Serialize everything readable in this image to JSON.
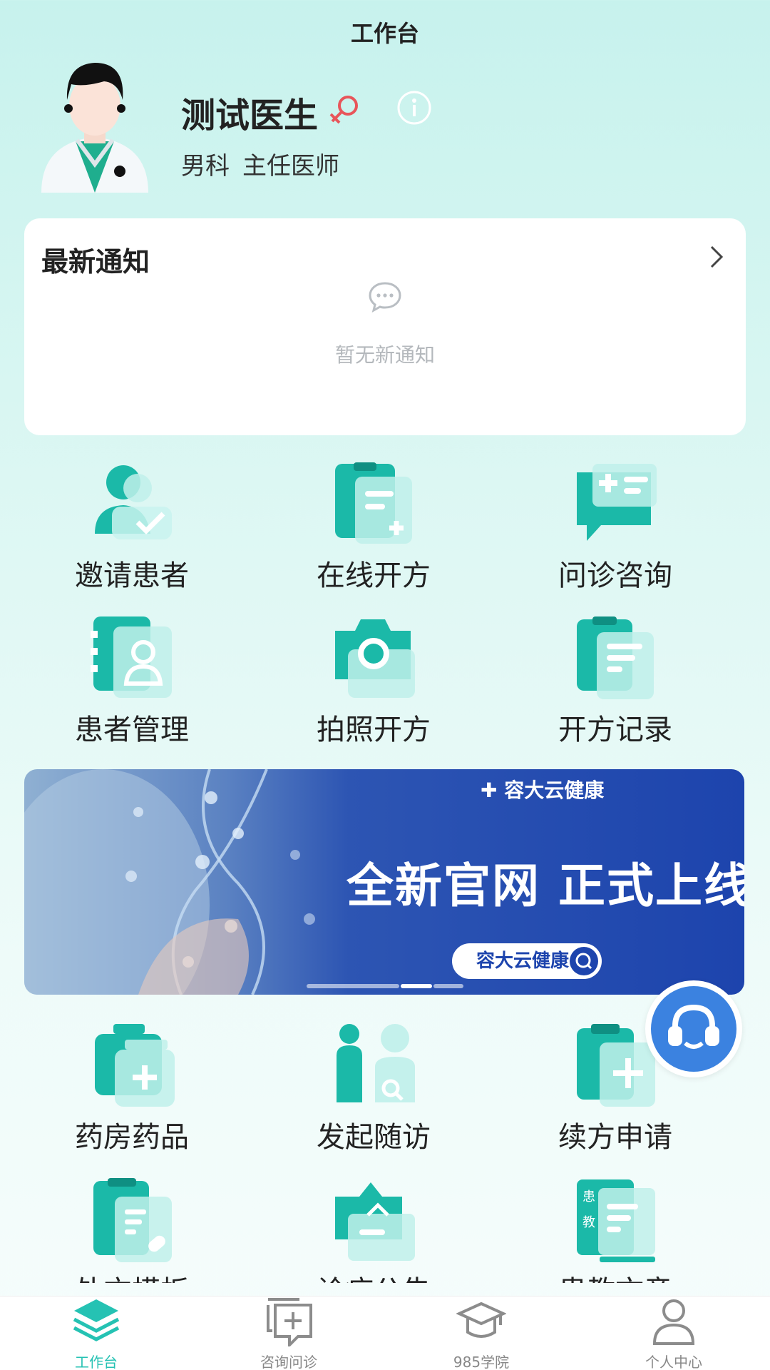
{
  "header": {
    "title": "工作台"
  },
  "doctor": {
    "name": "测试医生",
    "department": "男科",
    "title": "主任医师",
    "gender_icon": "female-symbol-icon",
    "info_icon": "info-icon"
  },
  "notice": {
    "title": "最新通知",
    "empty_text": "暂无新通知"
  },
  "grid_top": [
    {
      "label": "邀请患者",
      "icon": "invite-patient-icon"
    },
    {
      "label": "在线开方",
      "icon": "online-prescription-icon"
    },
    {
      "label": "问诊咨询",
      "icon": "consultation-icon"
    },
    {
      "label": "患者管理",
      "icon": "patient-management-icon"
    },
    {
      "label": "拍照开方",
      "icon": "photo-prescription-icon"
    },
    {
      "label": "开方记录",
      "icon": "prescription-record-icon"
    }
  ],
  "banner": {
    "logo_text": "容大云健康",
    "headline": "全新官网   正式上线",
    "pill_text": "容大云健康",
    "page_count": 3,
    "active_page": 2
  },
  "grid_bottom": [
    {
      "label": "药房药品",
      "icon": "pharmacy-icon"
    },
    {
      "label": "发起随访",
      "icon": "follow-up-icon"
    },
    {
      "label": "续方申请",
      "icon": "renew-prescription-icon"
    },
    {
      "label": "处方模板",
      "icon": "prescription-template-icon"
    },
    {
      "label": "诊疗公告",
      "icon": "announcement-icon"
    },
    {
      "label": "患教文章",
      "icon": "patient-education-icon"
    }
  ],
  "tabbar": [
    {
      "label": "工作台",
      "icon": "layers-icon",
      "active": true
    },
    {
      "label": "咨询问诊",
      "icon": "chat-plus-icon",
      "active": false
    },
    {
      "label": "985学院",
      "icon": "graduation-cap-icon",
      "active": false
    },
    {
      "label": "个人中心",
      "icon": "user-icon",
      "active": false
    }
  ],
  "colors": {
    "accent": "#25c2b3",
    "icon_dark": "#1bb9a8",
    "icon_light": "#bff0ea",
    "cs_button": "#3b82e0",
    "banner_blue": "#1d44ad"
  }
}
